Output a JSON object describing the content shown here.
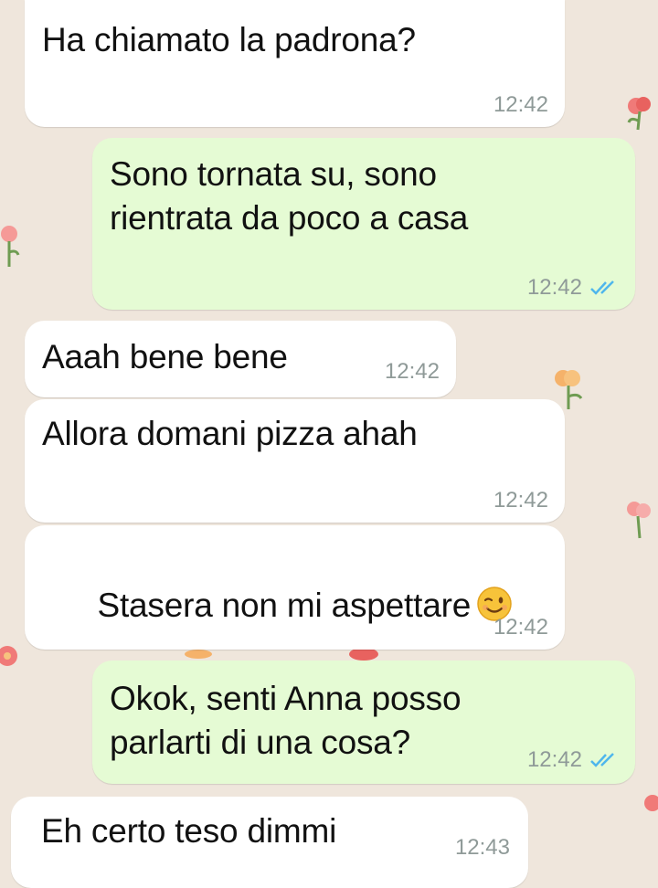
{
  "messages": [
    {
      "direction": "in",
      "text": "Ha chiamato la padrona?",
      "time": "12:42"
    },
    {
      "direction": "out",
      "text": "Sono tornata su, sono\nrientrata da poco a casa",
      "time": "12:42",
      "status": "read"
    },
    {
      "direction": "in",
      "text": "Aaah bene bene",
      "time": "12:42"
    },
    {
      "direction": "in",
      "text": "Allora domani pizza ahah",
      "time": "12:42"
    },
    {
      "direction": "in",
      "text": "Stasera non mi aspettare",
      "emoji": "winking-face",
      "time": "12:42"
    },
    {
      "direction": "out",
      "text": "Okok, senti Anna posso\nparlarti di una cosa?",
      "time": "12:42",
      "status": "read"
    },
    {
      "direction": "in",
      "text": "Eh certo teso dimmi",
      "time": "12:43"
    }
  ],
  "colors": {
    "background": "#efe6dc",
    "incoming_bubble": "#ffffff",
    "outgoing_bubble": "#e5fbd4",
    "read_ticks": "#4fb6ec",
    "timestamp": "#8f9a98"
  },
  "icons": {
    "read_receipt": "double-check-icon",
    "emoji": "winking-face-emoji",
    "wallpaper": "flower-doodle"
  }
}
